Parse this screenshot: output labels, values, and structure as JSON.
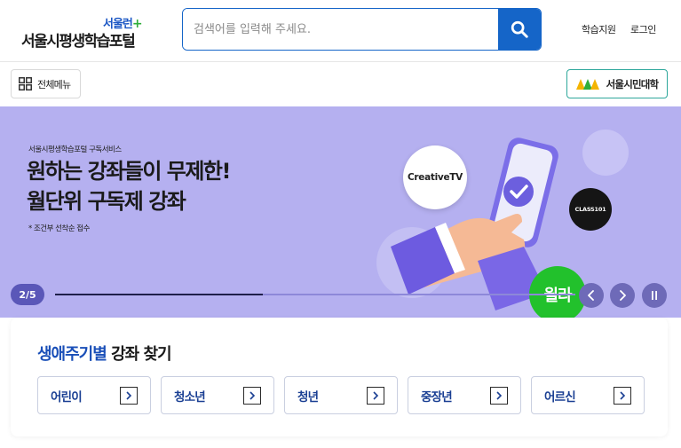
{
  "header": {
    "logo_sub": "서울런",
    "logo_plus": "+",
    "logo_main": "서울시평생학습포털",
    "search_placeholder": "검색어를 입력해 주세요.",
    "util_learn": "학습지원",
    "util_login": "로그인"
  },
  "subnav": {
    "allmenu_label": "전체메뉴",
    "citizen_label": "서울시민대학"
  },
  "banner": {
    "eyebrow": "서울시평생학습포털 구독서비스",
    "title_line1": "원하는 강좌들이 무제한!",
    "title_line2": "월단위 구독제 강좌",
    "note": "* 조건부 선착순 접수",
    "badge_creative": "CreativeTV",
    "badge_class": "CLASS101",
    "badge_wolla": "윌라",
    "pager": "2/5",
    "progress": 0.4
  },
  "lifecycle": {
    "title_highlight": "생애주기별",
    "title_rest": " 강좌 찾기",
    "buttons": [
      {
        "label": "어린이"
      },
      {
        "label": "청소년"
      },
      {
        "label": "청년"
      },
      {
        "label": "중장년"
      },
      {
        "label": "어르신"
      }
    ]
  },
  "colors": {
    "brand_blue": "#1565c8",
    "banner_bg": "#b5b0f0",
    "accent_green": "#2fae3a"
  }
}
